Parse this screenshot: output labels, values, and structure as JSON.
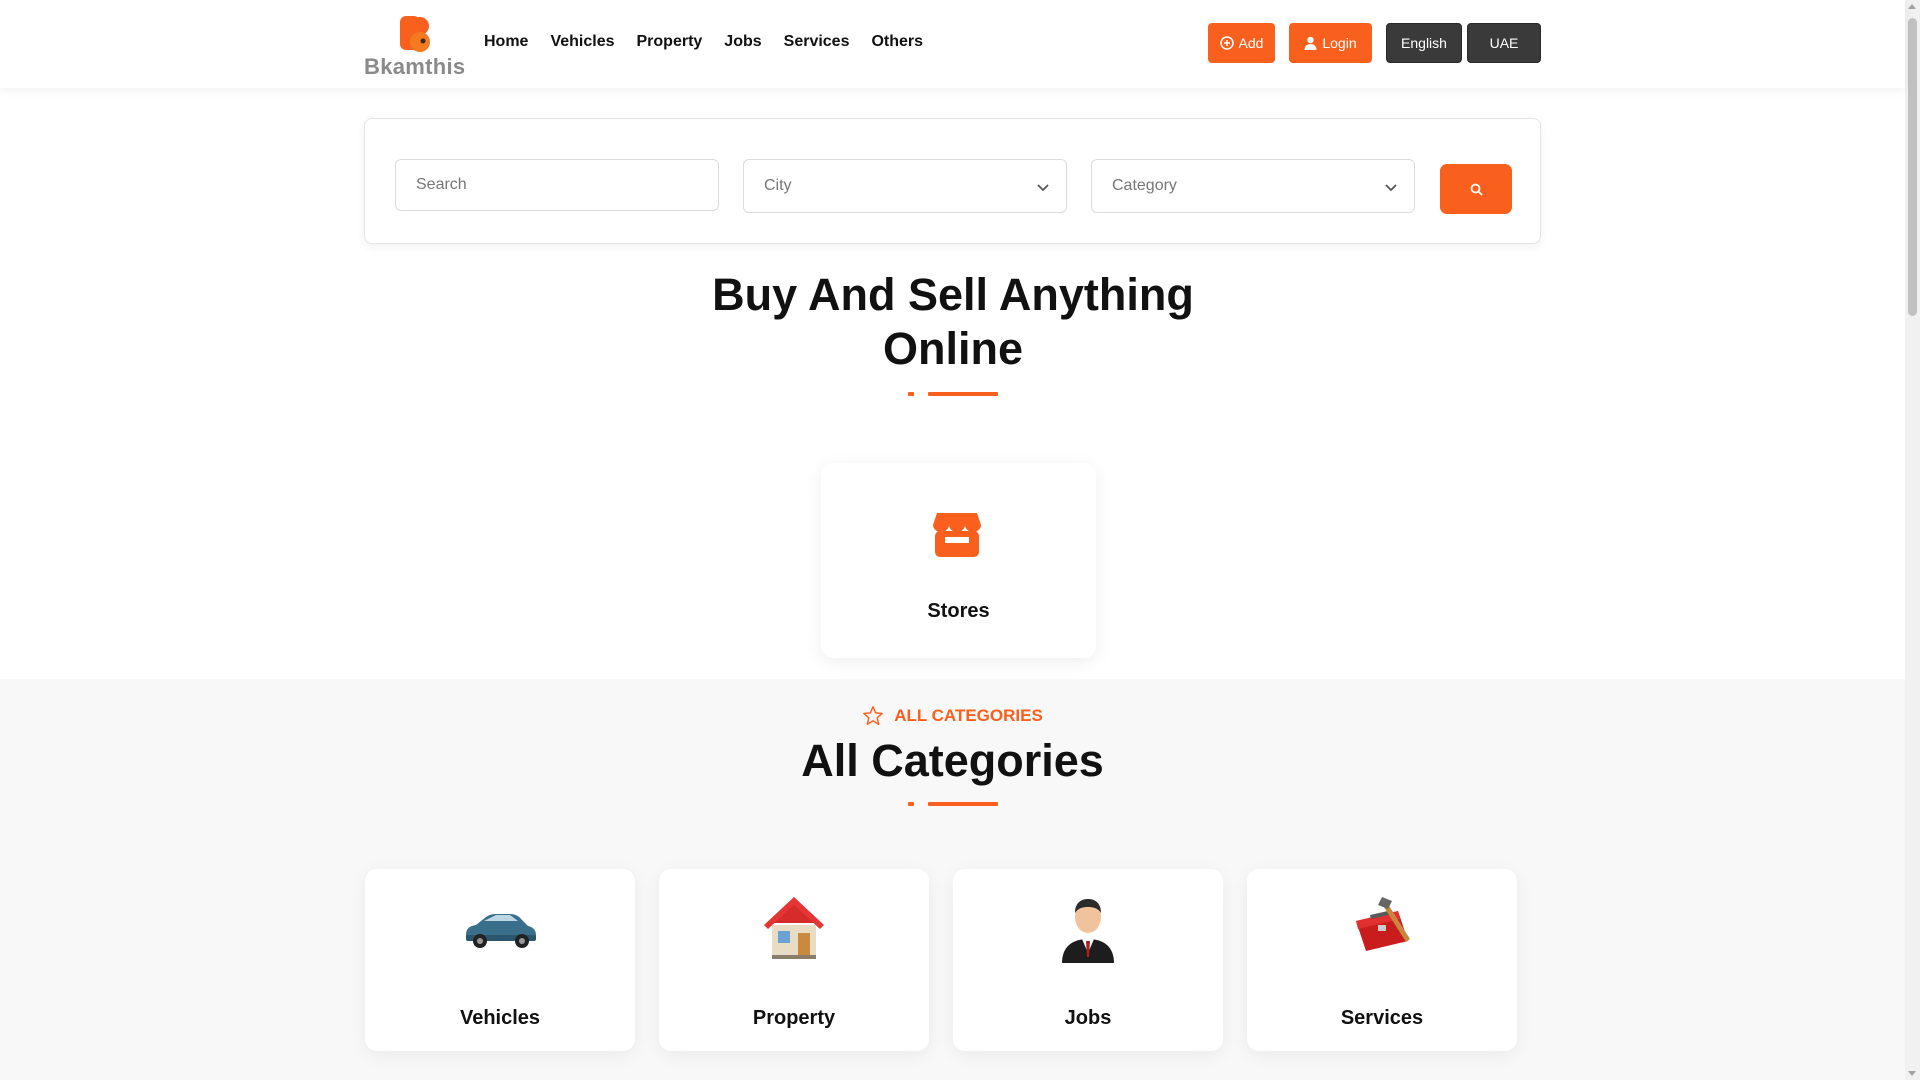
{
  "brand": {
    "name": "Bkamthis",
    "accent": "#f9601e",
    "dark": "#3a3a3a"
  },
  "nav": {
    "items": [
      "Home",
      "Vehicles",
      "Property",
      "Jobs",
      "Services",
      "Others"
    ]
  },
  "header_actions": {
    "add_label": "Add",
    "login_label": "Login",
    "language_label": "English",
    "country_label": "UAE"
  },
  "search": {
    "placeholder": "Search",
    "city_placeholder": "City",
    "category_placeholder": "Category",
    "search_icon": "search-icon"
  },
  "hero": {
    "title": "Buy And Sell Anything Online"
  },
  "stores": {
    "label": "Stores",
    "icon": "store-icon"
  },
  "categories": {
    "kicker": "ALL CATEGORIES",
    "kicker_icon": "star-icon",
    "title": "All Categories",
    "items": [
      {
        "label": "Vehicles",
        "icon": "car-icon"
      },
      {
        "label": "Property",
        "icon": "house-icon"
      },
      {
        "label": "Jobs",
        "icon": "businessman-icon"
      },
      {
        "label": "Services",
        "icon": "toolbox-icon"
      }
    ]
  }
}
